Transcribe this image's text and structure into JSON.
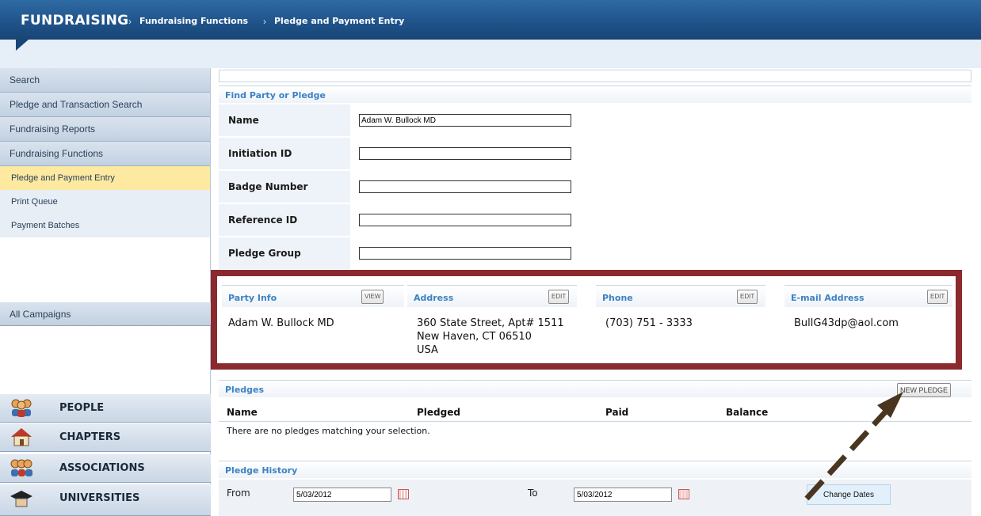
{
  "header": {
    "brand": "FUNDRAISING",
    "sep": "›",
    "crumb1": "Fundraising Functions",
    "crumb2": "Pledge and Payment Entry"
  },
  "sidebar": {
    "items": [
      {
        "label": "Search"
      },
      {
        "label": "Pledge and Transaction Search"
      },
      {
        "label": "Fundraising Reports"
      },
      {
        "label": "Fundraising Functions"
      }
    ],
    "sub": [
      {
        "label": "Pledge and Payment Entry"
      },
      {
        "label": "Print Queue"
      },
      {
        "label": "Payment Batches"
      }
    ],
    "campaigns": "All Campaigns",
    "modules": [
      {
        "label": "PEOPLE",
        "icon": "people-icon"
      },
      {
        "label": "CHAPTERS",
        "icon": "house-icon"
      },
      {
        "label": "ASSOCIATIONS",
        "icon": "group-icon"
      },
      {
        "label": "UNIVERSITIES",
        "icon": "graduation-cap-icon"
      }
    ]
  },
  "find": {
    "title": "Find Party or Pledge",
    "fields": [
      {
        "label": "Name",
        "value": "Adam W. Bullock MD"
      },
      {
        "label": "Initiation ID",
        "value": ""
      },
      {
        "label": "Badge Number",
        "value": ""
      },
      {
        "label": "Reference ID",
        "value": ""
      },
      {
        "label": "Pledge Group",
        "value": ""
      }
    ]
  },
  "party": {
    "info_title": "Party Info",
    "view_label": "VIEW",
    "address_title": "Address",
    "phone_title": "Phone",
    "email_title": "E-mail Address",
    "edit_label": "EDIT",
    "name": "Adam W. Bullock MD",
    "addr1": "360 State Street, Apt# 1511",
    "addr2": "New Haven, CT 06510",
    "addr3": "USA",
    "phone": "(703) 751 - 3333",
    "email": "BullG43dp@aol.com"
  },
  "pledges": {
    "title": "Pledges",
    "new_label": "NEW PLEDGE",
    "columns": [
      "Name",
      "Pledged",
      "Paid",
      "Balance"
    ],
    "empty": "There are no pledges matching your selection."
  },
  "history": {
    "title": "Pledge History",
    "from_label": "From",
    "from_value": "5/03/2012",
    "to_label": "To",
    "to_value": "5/03/2012",
    "change_label": "Change Dates"
  },
  "colors": {
    "accent": "#3c82c4",
    "highlight_box": "#8b2a2e",
    "header_bg": "#1f5289"
  }
}
